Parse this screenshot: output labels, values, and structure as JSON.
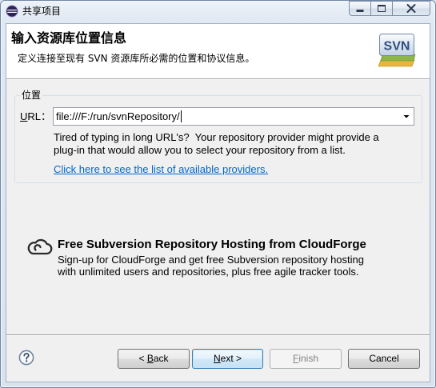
{
  "window": {
    "title": "共享项目",
    "icons": {
      "app": "eclipse-icon",
      "minimize": "minimize-icon",
      "maximize": "maximize-icon",
      "close": "close-icon"
    }
  },
  "header": {
    "title": "输入资源库位置信息",
    "description": "定义连接至现有 SVN 资源库所必需的位置和协议信息。",
    "logo_icon": "svn-logo-icon",
    "logo_text": "SVN"
  },
  "location": {
    "group_label": "位置",
    "url_label": "URL：",
    "url_mnemonic": "U",
    "url_value": "file:///F:/run/svnRepository/",
    "dropdown_icon": "chevron-down-icon",
    "hint_lines": [
      "Tired of typing in long URL's?  Your repository provider might provide a",
      "plug-in that would allow you to select your repository from a list."
    ],
    "providers_link": "Click here to see the list of available providers."
  },
  "cloudforge": {
    "icon": "cloudforge-icon",
    "title": "Free Subversion Repository Hosting from CloudForge",
    "description_lines": [
      "Sign-up for CloudForge and get free Subversion repository hosting",
      "with unlimited users and repositories, plus free agile tracker tools."
    ]
  },
  "footer": {
    "help_icon": "help-icon",
    "buttons": {
      "back": {
        "label": "< Back",
        "mnemonic": "B",
        "enabled": true
      },
      "next": {
        "label": "Next >",
        "mnemonic": "N",
        "enabled": true,
        "default": true
      },
      "finish": {
        "label": "Finish",
        "mnemonic": "F",
        "enabled": false
      },
      "cancel": {
        "label": "Cancel",
        "enabled": true
      }
    }
  },
  "colors": {
    "link": "#0066cc",
    "header_background": "#ffffff",
    "dialog_background": "#f0f0f0",
    "default_button_border": "#3c7fb1",
    "disabled_text": "#838383"
  }
}
